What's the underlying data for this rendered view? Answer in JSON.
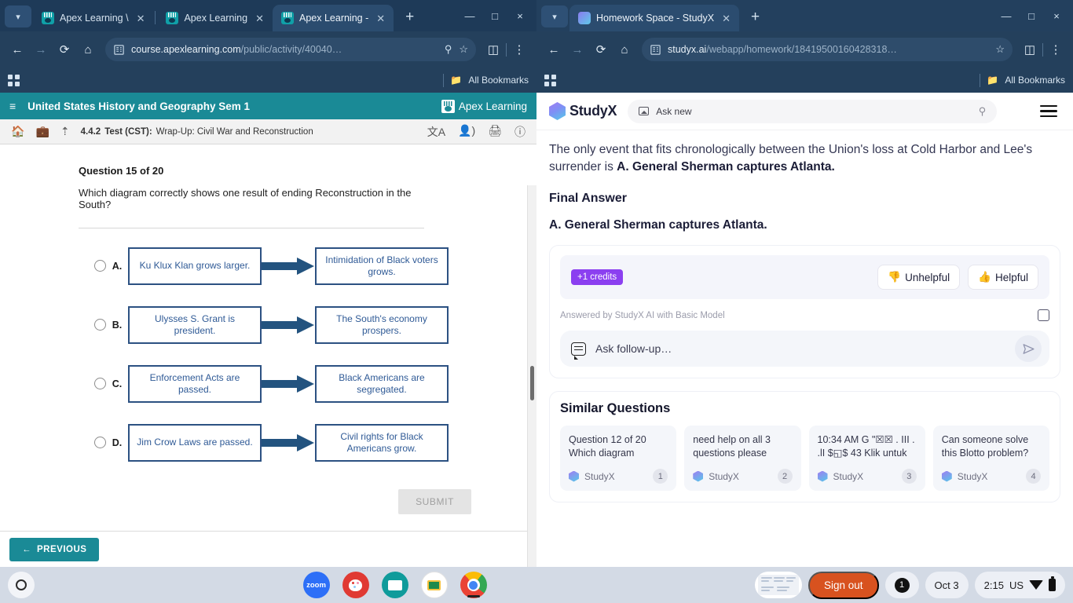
{
  "left_browser": {
    "tabs": [
      {
        "title": "Apex Learning \\",
        "favicon": "apex-favicon",
        "active": false
      },
      {
        "title": "Apex Learning",
        "favicon": "apex-favicon",
        "active": false
      },
      {
        "title": "Apex Learning -",
        "favicon": "apex-favicon",
        "active": true
      }
    ],
    "new_tab_label": "+",
    "window_controls": {
      "minimize": "—",
      "maximize": "□",
      "close": "×"
    },
    "url_host": "course.apexlearning.com",
    "url_path": "/public/activity/40040…",
    "bookmarks_label": "All Bookmarks"
  },
  "right_browser": {
    "tabs": [
      {
        "title": "Homework Space - StudyX",
        "favicon": "studyx-favicon",
        "active": true
      }
    ],
    "new_tab_label": "+",
    "window_controls": {
      "minimize": "—",
      "maximize": "□",
      "close": "×"
    },
    "url_host": "studyx.ai",
    "url_path": "/webapp/homework/18419500160428318…",
    "bookmarks_label": "All Bookmarks"
  },
  "apex": {
    "course_title": "United States History and Geography Sem 1",
    "brand": "Apex Learning",
    "breadcrumb": {
      "number": "4.4.2",
      "type": "Test (CST):",
      "name": "Wrap-Up: Civil War and Reconstruction"
    },
    "question_number": "Question 15 of 20",
    "question_text": "Which diagram correctly shows one result of ending Reconstruction in the South?",
    "choices": [
      {
        "letter": "A.",
        "cause": "Ku Klux Klan grows larger.",
        "effect": "Intimidation of Black voters grows."
      },
      {
        "letter": "B.",
        "cause": "Ulysses S. Grant is president.",
        "effect": "The South's economy prospers."
      },
      {
        "letter": "C.",
        "cause": "Enforcement Acts are passed.",
        "effect": "Black Americans are segregated."
      },
      {
        "letter": "D.",
        "cause": "Jim Crow Laws are passed.",
        "effect": "Civil rights for Black Americans grow."
      }
    ],
    "submit_label": "SUBMIT",
    "previous_label": "PREVIOUS",
    "accent_color": "#1a8a96",
    "diagram_color": "#23537f"
  },
  "studyx": {
    "logo_text": "StudyX",
    "ask_placeholder": "Ask new",
    "answer_paragraph_plain": "The only event that fits chronologically between the Union's loss at Cold Harbor and Lee's surrender is ",
    "answer_paragraph_bold": "A. General Sherman captures Atlanta.",
    "final_answer_heading": "Final Answer",
    "final_answer_text": "A. General Sherman captures Atlanta.",
    "credits_badge": "+1 credits",
    "unhelpful_label": "Unhelpful",
    "helpful_label": "Helpful",
    "answered_by": "Answered by StudyX AI with Basic Model",
    "followup_placeholder": "Ask follow-up…",
    "similar_questions_title": "Similar Questions",
    "similar_questions": [
      {
        "text": "Question 12 of 20 Which diagram",
        "brand": "StudyX",
        "index": "1"
      },
      {
        "text": "need help on all 3 questions please",
        "brand": "StudyX",
        "index": "2"
      },
      {
        "text": "10:34 AM G \"☒☒ . III . .lI $◱$ 43 Klik untuk",
        "brand": "StudyX",
        "index": "3"
      },
      {
        "text": "Can someone solve this Blotto problem?",
        "brand": "StudyX",
        "index": "4"
      }
    ],
    "credits_color": "#8b3ff0"
  },
  "taskbar": {
    "apps": [
      {
        "name": "zoom",
        "label": "zoom"
      },
      {
        "name": "paint",
        "label": ""
      },
      {
        "name": "news",
        "label": ""
      },
      {
        "name": "classroom",
        "label": ""
      },
      {
        "name": "chrome",
        "label": ""
      }
    ],
    "sign_out_label": "Sign out",
    "notification_count": "1",
    "date": "Oct 3",
    "time": "2:15",
    "locale": "US"
  }
}
